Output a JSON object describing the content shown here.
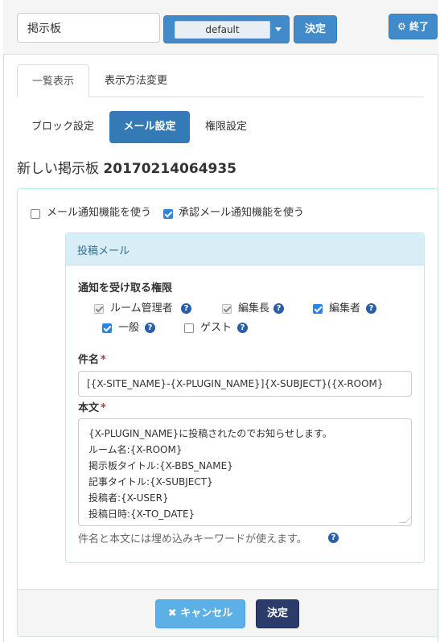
{
  "header": {
    "page_name_value": "掲示板",
    "theme_select_value": "default",
    "decide_label": "決定",
    "exit_label": "終了"
  },
  "tabs": [
    {
      "label": "一覧表示",
      "active": true
    },
    {
      "label": "表示方法変更",
      "active": false
    }
  ],
  "pills": [
    {
      "label": "ブロック設定",
      "active": false
    },
    {
      "label": "メール設定",
      "active": true
    },
    {
      "label": "権限設定",
      "active": false
    }
  ],
  "page_title": {
    "prefix": "新しい掲示板",
    "suffix": "20170214064935"
  },
  "options": {
    "mail_notify_label": "メール通知機能を使う",
    "mail_notify_checked": false,
    "approval_notify_label": "承認メール通知機能を使う",
    "approval_notify_checked": true
  },
  "post_mail": {
    "heading": "投稿メール",
    "recipients_label": "通知を受け取る権限",
    "roles": [
      {
        "label": "ルーム管理者",
        "checked": true,
        "disabled": true
      },
      {
        "label": "編集長",
        "checked": true,
        "disabled": true
      },
      {
        "label": "編集者",
        "checked": true,
        "disabled": false
      },
      {
        "label": "一般",
        "checked": true,
        "disabled": false
      },
      {
        "label": "ゲスト",
        "checked": false,
        "disabled": false
      }
    ],
    "subject_label": "件名",
    "subject_value": "[{X-SITE_NAME}-{X-PLUGIN_NAME}]{X-SUBJECT}({X-ROOM}",
    "body_label": "本文",
    "body_lines": [
      "{X-PLUGIN_NAME}に投稿されたのでお知らせします。",
      "ルーム名:{X-ROOM}",
      "掲示板タイトル:{X-BBS_NAME}",
      "記事タイトル:{X-SUBJECT}",
      "投稿者:{X-USER}",
      "投稿日時:{X-TO_DATE}"
    ],
    "hint": "件名と本文には埋め込みキーワードが使えます。"
  },
  "footer": {
    "cancel_label": "キャンセル",
    "decide_label": "決定"
  },
  "colors": {
    "primary": "#428bca",
    "active_pill": "#337ab7",
    "decide_dark": "#2b3c6b",
    "cancel": "#5cb0e6",
    "panel_border": "#bce8f1",
    "panel_heading_bg": "#d9edf7"
  },
  "icons": {
    "exit": "gear-icon",
    "cancel": "close-icon",
    "help": "question-circle-icon"
  }
}
